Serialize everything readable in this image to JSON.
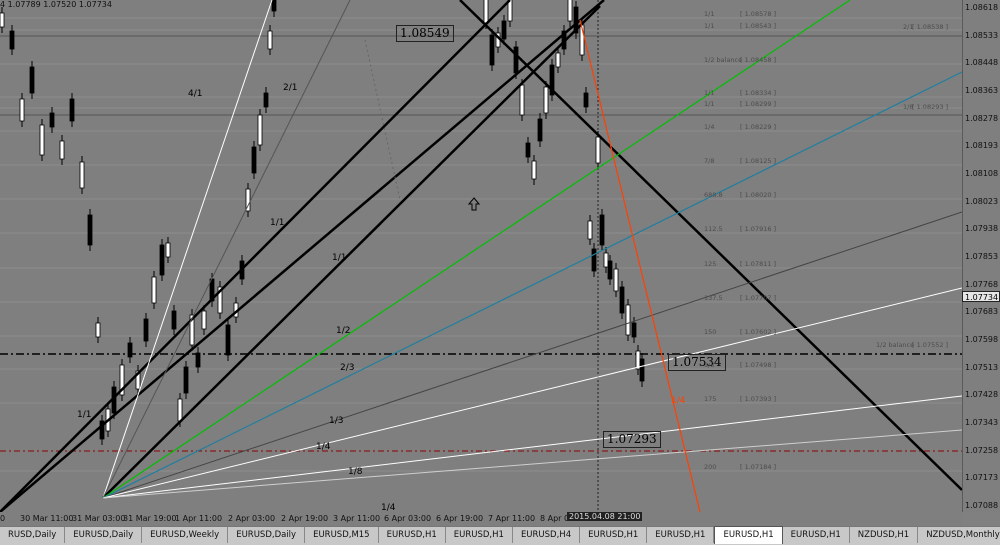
{
  "info_line": "4 1.07789 1.07520 1.07734",
  "price_axis": {
    "ticks": [
      "1.08618",
      "1.08533",
      "1.08448",
      "1.08363",
      "1.08278",
      "1.08193",
      "1.08108",
      "1.08023",
      "1.07938",
      "1.07853",
      "1.07768",
      "1.07683",
      "1.07598",
      "1.07513",
      "1.07428",
      "1.07343",
      "1.07258",
      "1.07173",
      "1.07088"
    ],
    "current_price": "1.07734"
  },
  "time_axis": {
    "ticks": [
      "0",
      "30 Mar 11:00",
      "31 Mar 03:00",
      "31 Mar 19:00",
      "1 Apr 11:00",
      "2 Apr 03:00",
      "2 Apr 19:00",
      "3 Apr 11:00",
      "6 Apr 03:00",
      "6 Apr 19:00",
      "7 Apr 11:00",
      "8 Apr 0"
    ],
    "cursor_label": "2015.04.08 21:00"
  },
  "price_boxes": {
    "upper": "1.08549",
    "middle": "1.07534",
    "lower": "1.07293"
  },
  "gann_labels": [
    "4/1",
    "2/1",
    "1/1",
    "1/1",
    "1/2",
    "2/3",
    "1/3",
    "1/4",
    "1/8",
    "1/4",
    "1/1"
  ],
  "fan_label_red": "1/4",
  "murrey_levels": [
    {
      "left": "1/1",
      "right": "1.08578"
    },
    {
      "left": "1/1",
      "right": "1.08543"
    },
    {
      "left": "1/2 balance",
      "right": "1.08458"
    },
    {
      "left": "1/1",
      "right": "1.08334"
    },
    {
      "left": "1/1",
      "right": "1.08299"
    },
    {
      "left": "1/4",
      "right": "1.08229"
    },
    {
      "left": "7/8",
      "right": "1.08125"
    },
    {
      "left": "688.8",
      "right": "1.08020"
    },
    {
      "left": "112.5",
      "right": "1.07916"
    },
    {
      "left": "125",
      "right": "1.07811"
    },
    {
      "left": "137.5",
      "right": "1.07707"
    },
    {
      "left": "150",
      "right": "1.07602"
    },
    {
      "left": "1/3",
      "right": "1.07498"
    },
    {
      "left": "175",
      "right": "1.07393"
    },
    {
      "left": "200",
      "right": "1.07184"
    }
  ],
  "murrey_right": [
    {
      "label": "2/1",
      "value": "1.08538"
    },
    {
      "label": "1/8",
      "value": "1.08293"
    },
    {
      "label": "1/2 balance",
      "value": "1.07552"
    }
  ],
  "tabs": [
    {
      "label": "RUSD,Daily",
      "active": false
    },
    {
      "label": "EURUSD,Daily",
      "active": false
    },
    {
      "label": "EURUSD,Weekly",
      "active": false
    },
    {
      "label": "EURUSD,Daily",
      "active": false
    },
    {
      "label": "EURUSD,M15",
      "active": false
    },
    {
      "label": "EURUSD,H1",
      "active": false
    },
    {
      "label": "EURUSD,H1",
      "active": false
    },
    {
      "label": "EURUSD,H4",
      "active": false
    },
    {
      "label": "EURUSD,H1",
      "active": false
    },
    {
      "label": "EURUSD,H1",
      "active": false
    },
    {
      "label": "EURUSD,H1",
      "active": true
    },
    {
      "label": "EURUSD,H1",
      "active": false
    },
    {
      "label": "NZDUSD,H1",
      "active": false
    },
    {
      "label": "NZDUSD,Monthly",
      "active": false
    }
  ],
  "colors": {
    "background": "#7f7f7f",
    "gann_main": "#000000",
    "fan_green": "#00c000",
    "fan_teal": "#1f7f9f",
    "fan_red": "#ff4000",
    "fan_white": "#ffffff",
    "level_dash": "#000000",
    "level_red": "#8b0000"
  }
}
